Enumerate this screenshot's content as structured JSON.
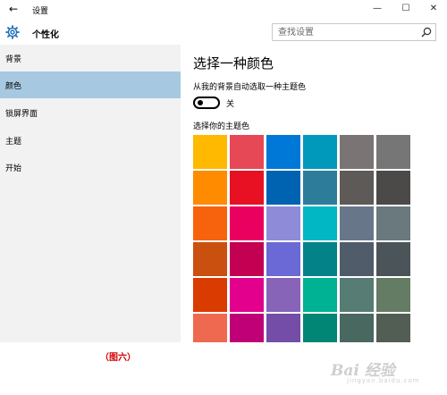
{
  "window": {
    "title": "设置",
    "back_glyph": "←",
    "minimize_glyph": "—",
    "maximize_glyph": "☐",
    "close_glyph": "✕"
  },
  "header": {
    "title": "个性化",
    "search_placeholder": "查找设置"
  },
  "sidebar": {
    "items": [
      {
        "label": "背景",
        "active": false
      },
      {
        "label": "颜色",
        "active": true
      },
      {
        "label": "锁屏界面",
        "active": false
      },
      {
        "label": "主题",
        "active": false
      },
      {
        "label": "开始",
        "active": false
      }
    ]
  },
  "main": {
    "heading": "选择一种颜色",
    "auto_color_label": "从我的背景自动选取一种主题色",
    "toggle_state": "关",
    "theme_label": "选择你的主题色",
    "swatches": [
      [
        "#ffb900",
        "#e74856",
        "#0078d7",
        "#0099bc",
        "#7a7574",
        "#767676"
      ],
      [
        "#ff8c00",
        "#e81123",
        "#0063b1",
        "#2d7d9a",
        "#5d5a58",
        "#4c4a48"
      ],
      [
        "#f7630c",
        "#ea005e",
        "#8e8cd8",
        "#00b7c3",
        "#68768a",
        "#69797e"
      ],
      [
        "#ca5010",
        "#c30052",
        "#6b69d6",
        "#038387",
        "#515c6b",
        "#4a5459"
      ],
      [
        "#da3b01",
        "#e3008c",
        "#8764b8",
        "#00b294",
        "#567c73",
        "#647c64"
      ],
      [
        "#ef6950",
        "#bf0077",
        "#744da9",
        "#018574",
        "#486860",
        "#525e54"
      ]
    ]
  },
  "caption": "（图六）",
  "watermark": {
    "text": "Bai 经验",
    "sub": "jingyan.baidu.com"
  },
  "colors": {
    "sidebar_bg": "#f2f2f2",
    "active_item_bg": "#a6c9e1",
    "caption": "#d40000"
  }
}
